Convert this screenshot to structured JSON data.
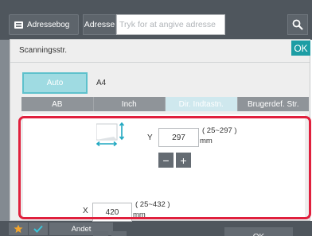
{
  "topbar": {
    "addressbook_label": "Adressebog",
    "address_tab_label": "Adresse",
    "address_placeholder": "Tryk for at angive adresse",
    "search_icon": "search-icon"
  },
  "dialog": {
    "title": "Scanningsstr.",
    "ok_label": "OK",
    "auto_label": "Auto",
    "auto_value": "A4",
    "tabs": [
      {
        "label": "AB",
        "active": false
      },
      {
        "label": "Inch",
        "active": false
      },
      {
        "label": "Dir. Indtastn.",
        "active": true
      },
      {
        "label": "Brugerdef. Str.",
        "active": false
      }
    ],
    "y": {
      "label": "Y",
      "value": "297",
      "range": "( 25~297 )",
      "unit": "mm",
      "minus_label": "−",
      "plus_label": "+"
    },
    "x": {
      "label": "X",
      "value": "420",
      "range": "( 25~432 )",
      "unit": "mm",
      "minus_label": "−",
      "plus_label": "+"
    },
    "panel_ok_label": "OK"
  },
  "bottombar": {
    "other_label": "Andet",
    "star_icon": "star-icon",
    "check_icon": "check-icon"
  },
  "colors": {
    "accent": "#1c9da4",
    "highlight": "#e0203d",
    "star": "#f2a52e",
    "check": "#3cc4d8"
  }
}
